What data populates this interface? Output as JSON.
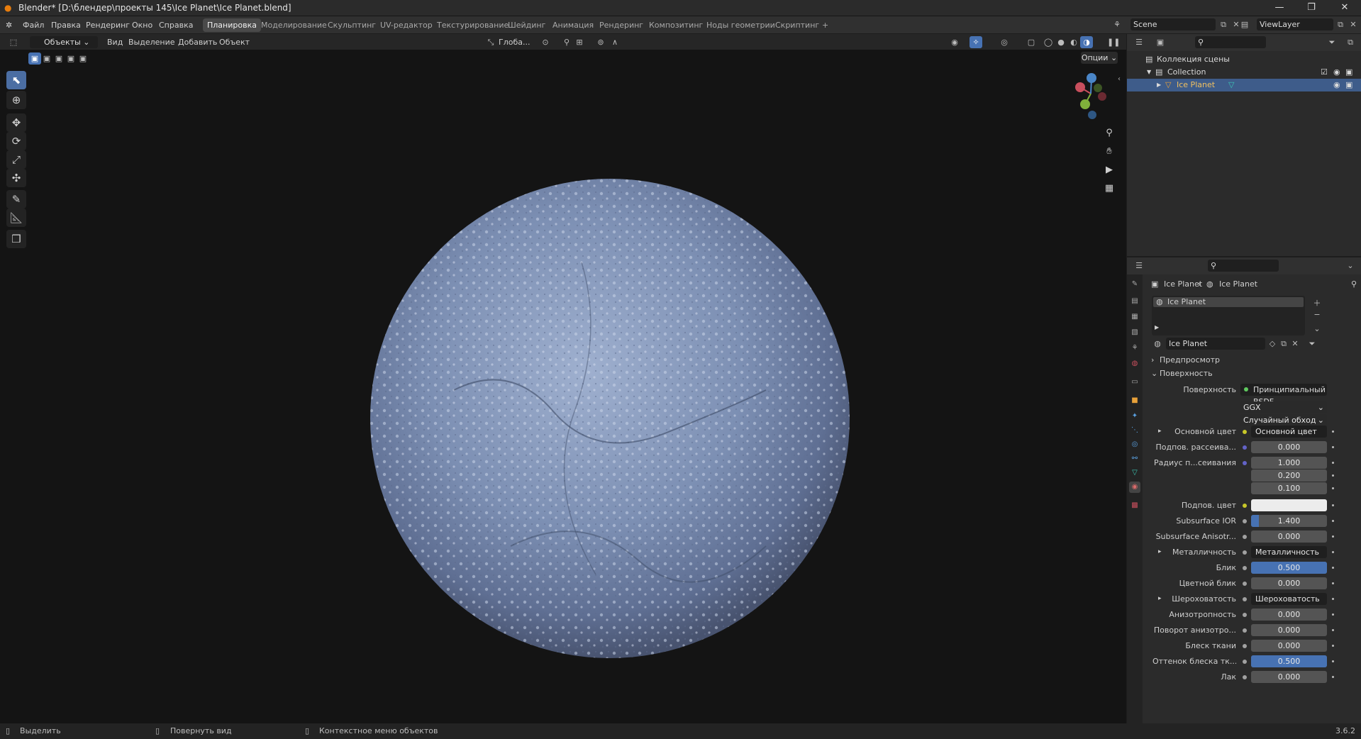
{
  "window": {
    "title": "Blender* [D:\\блендер\\проекты 145\\Ice Planet\\Ice Planet.blend]"
  },
  "menu": {
    "items": [
      "Файл",
      "Правка",
      "Рендеринг",
      "Окно",
      "Справка"
    ]
  },
  "workspaces": {
    "tabs": [
      "Планировка",
      "Моделирование",
      "Скульптинг",
      "UV-редактор",
      "Текстурирование",
      "Шейдинг",
      "Анимация",
      "Рендеринг",
      "Композитинг",
      "Ноды геометрии",
      "Скриптинг"
    ],
    "active": "Планировка",
    "add": "+"
  },
  "scene": {
    "name": "Scene",
    "view_layer": "ViewLayer"
  },
  "viewport_header": {
    "mode": "Объекты",
    "menus": [
      "Вид",
      "Выделение",
      "Добавить",
      "Объект"
    ],
    "transform_orientation": "Глоба...",
    "options": "Опции"
  },
  "outliner": {
    "root": "Коллекция сцены",
    "collection": "Collection",
    "object": "Ice Planet"
  },
  "properties": {
    "breadcrumb": [
      "Ice Planet",
      "Ice Planet"
    ],
    "slot": "Ice Planet",
    "material_name": "Ice Planet",
    "panels": {
      "preview": "Предпросмотр",
      "surface": "Поверхность"
    },
    "surface_label": "Поверхность",
    "surface_shader": "Принципиальный BSDF",
    "distribution": "GGX",
    "subsurface_method": "Случайный обход",
    "rows": [
      {
        "label": "Основной цвет",
        "value": "Основной цвет",
        "type": "link",
        "socket": "#c7c729"
      },
      {
        "label": "Подпов. рассеива...",
        "value": "0.000",
        "type": "num",
        "socket": "#6363c7"
      },
      {
        "label": "Радиус п...сеивания",
        "value": "1.000",
        "type": "num",
        "socket": "#6363c7"
      },
      {
        "label": "",
        "value": "0.200",
        "type": "num",
        "socket": ""
      },
      {
        "label": "",
        "value": "0.100",
        "type": "num",
        "socket": ""
      },
      {
        "label": "Подпов. цвет",
        "value": "",
        "type": "color",
        "socket": "#c7c729"
      },
      {
        "label": "Subsurface IOR",
        "value": "1.400",
        "type": "num",
        "socket": "#a1a1a1",
        "fill": 0.1
      },
      {
        "label": "Subsurface Anisotr...",
        "value": "0.000",
        "type": "num",
        "socket": "#a1a1a1"
      },
      {
        "label": "Металличность",
        "value": "Металличность",
        "type": "link",
        "socket": "#a1a1a1"
      },
      {
        "label": "Блик",
        "value": "0.500",
        "type": "num",
        "socket": "#a1a1a1",
        "fill": 1
      },
      {
        "label": "Цветной блик",
        "value": "0.000",
        "type": "num",
        "socket": "#a1a1a1"
      },
      {
        "label": "Шероховатость",
        "value": "Шероховатость",
        "type": "link",
        "socket": "#a1a1a1"
      },
      {
        "label": "Анизотропность",
        "value": "0.000",
        "type": "num",
        "socket": "#a1a1a1"
      },
      {
        "label": "Поворот анизотро...",
        "value": "0.000",
        "type": "num",
        "socket": "#a1a1a1"
      },
      {
        "label": "Блеск ткани",
        "value": "0.000",
        "type": "num",
        "socket": "#a1a1a1"
      },
      {
        "label": "Оттенок блеска тк...",
        "value": "0.500",
        "type": "num",
        "socket": "#a1a1a1",
        "fill": 1
      },
      {
        "label": "Лак",
        "value": "0.000",
        "type": "num",
        "socket": "#a1a1a1"
      }
    ]
  },
  "statusbar": {
    "select": "Выделить",
    "rotate": "Повернуть вид",
    "context": "Контекстное меню объектов",
    "version": "3.6.2"
  },
  "colors": {
    "accent": "#4772b3",
    "selection": "#3e5c8a",
    "planet": "#7e93b8",
    "brand": "#e87d0d"
  }
}
